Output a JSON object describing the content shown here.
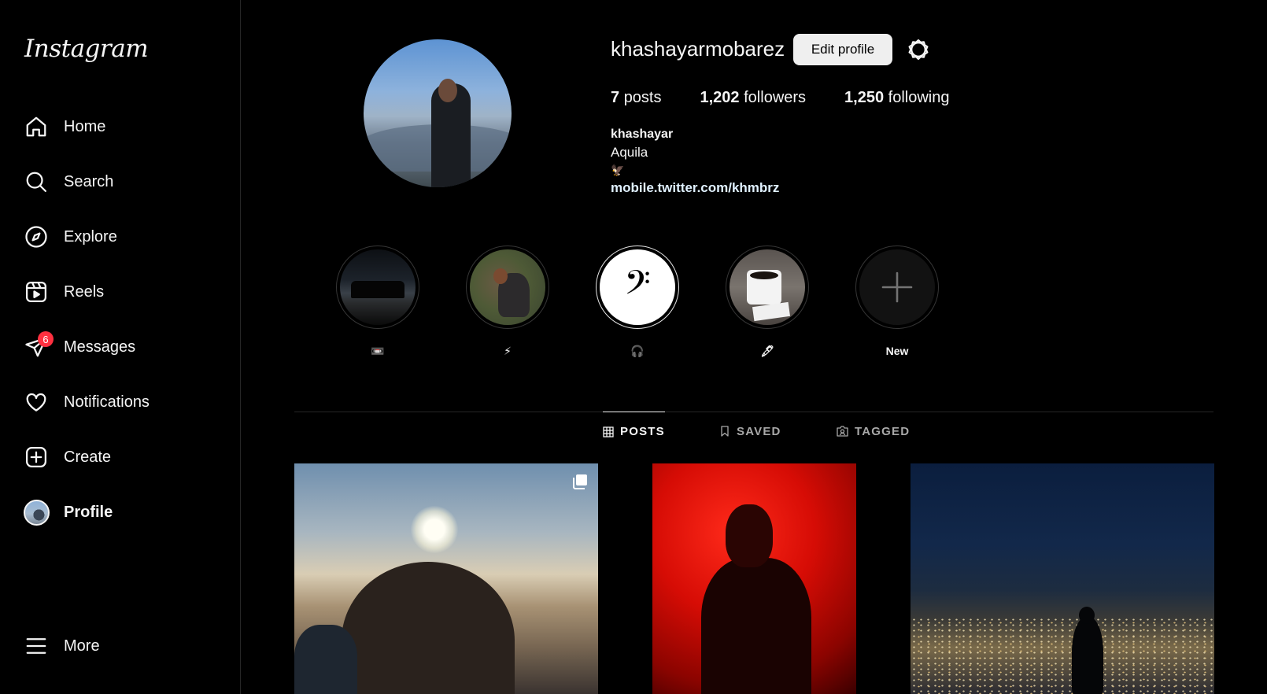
{
  "app": {
    "logo": "Instagram"
  },
  "sidebar": {
    "items": [
      {
        "label": "Home",
        "icon": "home-icon"
      },
      {
        "label": "Search",
        "icon": "search-icon"
      },
      {
        "label": "Explore",
        "icon": "compass-icon"
      },
      {
        "label": "Reels",
        "icon": "reels-icon"
      },
      {
        "label": "Messages",
        "icon": "send-icon",
        "badge": "6"
      },
      {
        "label": "Notifications",
        "icon": "heart-icon"
      },
      {
        "label": "Create",
        "icon": "plus-square-icon"
      },
      {
        "label": "Profile",
        "icon": "avatar",
        "active": true
      }
    ],
    "more": {
      "label": "More",
      "icon": "menu-icon"
    }
  },
  "profile": {
    "username": "khashayarmobarez",
    "edit_label": "Edit profile",
    "posts_count": "7",
    "posts_label": "posts",
    "followers_count": "1,202",
    "followers_label": "followers",
    "following_count": "1,250",
    "following_label": "following",
    "display_name": "khashayar",
    "bio": "Aquila",
    "bio_emoji": "🦅",
    "link": "mobile.twitter.com/khmbrz"
  },
  "highlights": [
    {
      "label": "📼",
      "image": "group-silhouette-night"
    },
    {
      "label": "⚡",
      "image": "person-hiking"
    },
    {
      "label": "🎧",
      "image": "bass-clef"
    },
    {
      "label": "🖋",
      "image": "coffee-mug"
    },
    {
      "label": "New",
      "image": "plus-icon"
    }
  ],
  "tabs": [
    {
      "label": "POSTS",
      "icon": "grid-icon",
      "active": true
    },
    {
      "label": "SAVED",
      "icon": "bookmark-icon"
    },
    {
      "label": "TAGGED",
      "icon": "tag-user-icon"
    }
  ],
  "colors": {
    "background": "#000000",
    "text": "#f5f5f5",
    "muted": "#a8a8a8",
    "badge": "#ff3040",
    "link": "#e0f1ff"
  }
}
